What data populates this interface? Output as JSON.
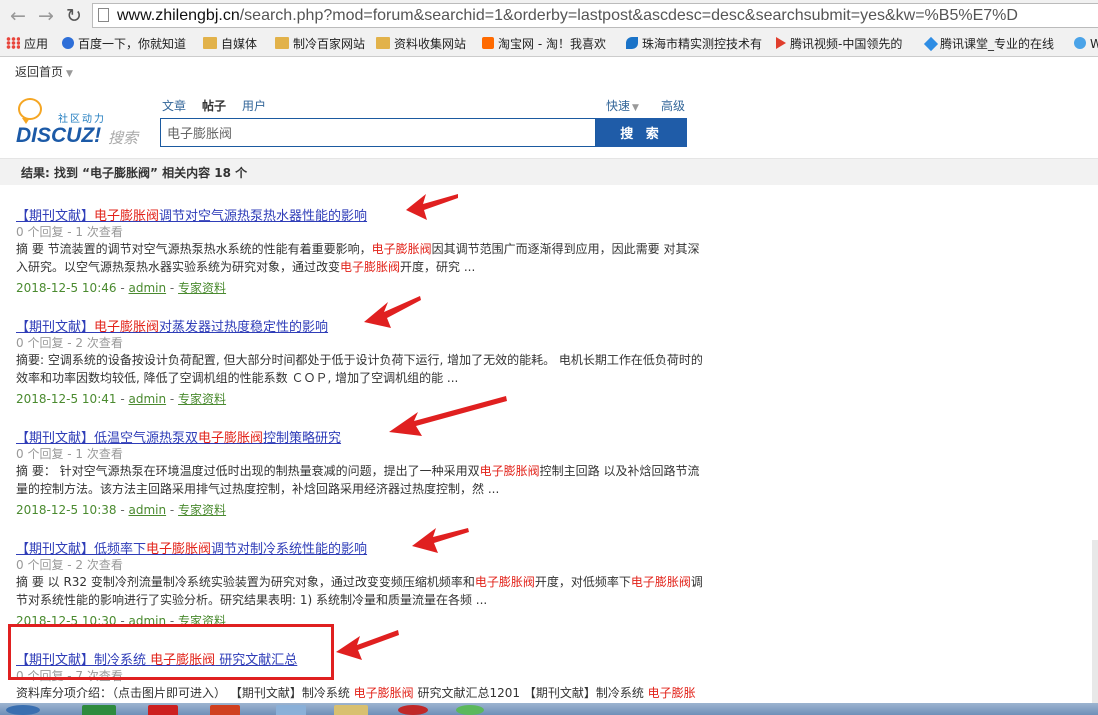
{
  "browser": {
    "url_domain": "www.zhilengbj.cn",
    "url_path": "/search.php?mod=forum&searchid=1&orderby=lastpost&ascdesc=desc&searchsubmit=yes&kw=%B5%E7%D",
    "bookmarks": [
      {
        "label": "应用",
        "icon": "apps-icon"
      },
      {
        "label": "百度一下，你就知道",
        "icon": "baidu-paw-icon"
      },
      {
        "label": "自媒体",
        "icon": "folder-icon"
      },
      {
        "label": "制冷百家网站",
        "icon": "folder-icon"
      },
      {
        "label": "资料收集网站",
        "icon": "folder-icon"
      },
      {
        "label": "淘宝网 - 淘！我喜欢",
        "icon": "taobao-icon"
      },
      {
        "label": "珠海市精实测控技术有",
        "icon": "fan-icon"
      },
      {
        "label": "腾讯视频-中国领先的",
        "icon": "play-icon"
      },
      {
        "label": "腾讯课堂_专业的在线",
        "icon": "diamond-icon"
      },
      {
        "label": "W",
        "icon": "snowflake-icon"
      }
    ]
  },
  "header": {
    "home_link": "返回首页",
    "logo_sub": "社区动力",
    "logo_main": "DISCUZ!",
    "logo_search": "搜索",
    "tabs": [
      "文章",
      "帖子",
      "用户"
    ],
    "active_tab": "帖子",
    "search_value": "电子膨胀阀",
    "search_button": "搜 索",
    "quick": "快速",
    "advanced": "高级"
  },
  "result_summary": "结果: 找到 “电子膨胀阀” 相关内容 18 个",
  "results": [
    {
      "title_pre": "【期刊文献】",
      "title_hl": "电子膨胀阀",
      "title_post": "调节对空气源热泵热水器性能的影响",
      "meta": "0 个回复 - 1 次查看",
      "abs_parts": [
        "摘 要 节流装置的调节对空气源热泵热水系统的性能有着重要影响，",
        "电子膨胀阀",
        "因其调节范围广而逐渐得到应用，因此需要 对其深入研究。以空气源热泵热水器实验系统为研究对象，通过改变",
        "电子膨胀阀",
        "开度，研究 ..."
      ],
      "date": "2018-12-5 10:46",
      "author": "admin",
      "forum": "专家资料"
    },
    {
      "title_pre": "【期刊文献】",
      "title_hl": "电子膨胀阀",
      "title_post": "对蒸发器过热度稳定性的影响",
      "meta": "0 个回复 - 2 次查看",
      "abs_parts": [
        "摘要: 空调系统的设备按设计负荷配置, 但大部分时间都处于低于设计负荷下运行, 增加了无效的能耗。 电机长期工作在低负荷时的效率和功率因数均较低, 降低了空调机组的性能系数 ＣＯＰ, 增加了空调机组的能 ..."
      ],
      "date": "2018-12-5 10:41",
      "author": "admin",
      "forum": "专家资料"
    },
    {
      "title_pre": "【期刊文献】低温空气源热泵双",
      "title_hl": "电子膨胀阀",
      "title_post": "控制策略研究",
      "meta": "0 个回复 - 1 次查看",
      "abs_parts": [
        "摘 要： 针对空气源热泵在环境温度过低时出现的制热量衰减的问题，提出了一种采用双",
        "电子膨胀阀",
        "控制主回路 以及补焓回路节流量的控制方法。该方法主回路采用排气过热度控制，补焓回路采用经济器过热度控制，然 ..."
      ],
      "date": "2018-12-5 10:38",
      "author": "admin",
      "forum": "专家资料"
    },
    {
      "title_pre": "【期刊文献】低频率下",
      "title_hl": "电子膨胀阀",
      "title_post": "调节对制冷系统性能的影响",
      "meta": "0 个回复 - 2 次查看",
      "abs_parts": [
        "摘 要 以 R32 变制冷剂流量制冷系统实验装置为研究对象，通过改变变频压缩机频率和",
        "电子膨胀阀",
        "开度，对低频率下",
        "电子膨胀阀",
        "调节对系统性能的影响进行了实验分析。研究结果表明: 1) 系统制冷量和质量流量在各频 ..."
      ],
      "date": "2018-12-5 10:30",
      "author": "admin",
      "forum": "专家资料"
    },
    {
      "title_pre": "【期刊文献】制冷系统 ",
      "title_hl": "电子膨胀阀",
      "title_post": " 研究文献汇总",
      "meta": "0 个回复 - 7 次查看",
      "abs_parts": [
        "资料库分项介绍：（点击图片即可进入） 【期刊文献】制冷系统 ",
        "电子膨胀阀",
        " 研究文献汇总1201 【期刊文献】制冷系统 ",
        "电子膨胀"
      ],
      "date": "",
      "author": "",
      "forum": ""
    }
  ],
  "colors": {
    "accent": "#1f5ca8",
    "highlight": "#e2231a",
    "link": "#2f3db8",
    "annotation": "#e02020"
  }
}
